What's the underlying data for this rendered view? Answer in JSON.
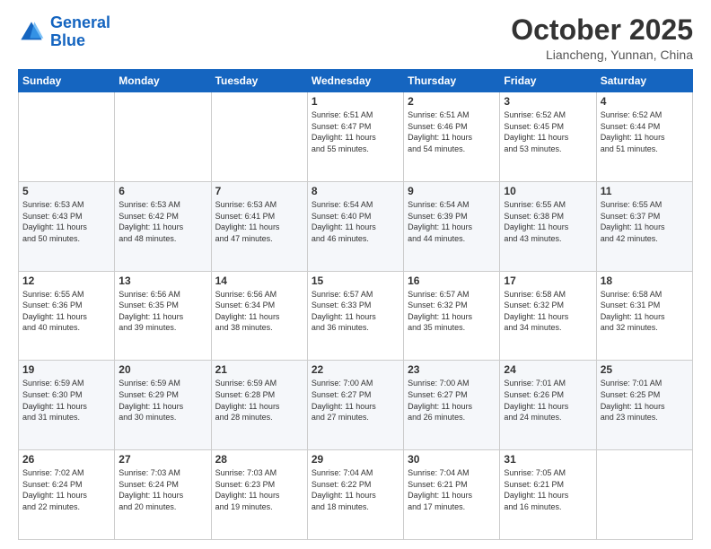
{
  "header": {
    "logo_line1": "General",
    "logo_line2": "Blue",
    "month": "October 2025",
    "location": "Liancheng, Yunnan, China"
  },
  "days_of_week": [
    "Sunday",
    "Monday",
    "Tuesday",
    "Wednesday",
    "Thursday",
    "Friday",
    "Saturday"
  ],
  "weeks": [
    [
      {
        "day": "",
        "info": ""
      },
      {
        "day": "",
        "info": ""
      },
      {
        "day": "",
        "info": ""
      },
      {
        "day": "1",
        "info": "Sunrise: 6:51 AM\nSunset: 6:47 PM\nDaylight: 11 hours\nand 55 minutes."
      },
      {
        "day": "2",
        "info": "Sunrise: 6:51 AM\nSunset: 6:46 PM\nDaylight: 11 hours\nand 54 minutes."
      },
      {
        "day": "3",
        "info": "Sunrise: 6:52 AM\nSunset: 6:45 PM\nDaylight: 11 hours\nand 53 minutes."
      },
      {
        "day": "4",
        "info": "Sunrise: 6:52 AM\nSunset: 6:44 PM\nDaylight: 11 hours\nand 51 minutes."
      }
    ],
    [
      {
        "day": "5",
        "info": "Sunrise: 6:53 AM\nSunset: 6:43 PM\nDaylight: 11 hours\nand 50 minutes."
      },
      {
        "day": "6",
        "info": "Sunrise: 6:53 AM\nSunset: 6:42 PM\nDaylight: 11 hours\nand 48 minutes."
      },
      {
        "day": "7",
        "info": "Sunrise: 6:53 AM\nSunset: 6:41 PM\nDaylight: 11 hours\nand 47 minutes."
      },
      {
        "day": "8",
        "info": "Sunrise: 6:54 AM\nSunset: 6:40 PM\nDaylight: 11 hours\nand 46 minutes."
      },
      {
        "day": "9",
        "info": "Sunrise: 6:54 AM\nSunset: 6:39 PM\nDaylight: 11 hours\nand 44 minutes."
      },
      {
        "day": "10",
        "info": "Sunrise: 6:55 AM\nSunset: 6:38 PM\nDaylight: 11 hours\nand 43 minutes."
      },
      {
        "day": "11",
        "info": "Sunrise: 6:55 AM\nSunset: 6:37 PM\nDaylight: 11 hours\nand 42 minutes."
      }
    ],
    [
      {
        "day": "12",
        "info": "Sunrise: 6:55 AM\nSunset: 6:36 PM\nDaylight: 11 hours\nand 40 minutes."
      },
      {
        "day": "13",
        "info": "Sunrise: 6:56 AM\nSunset: 6:35 PM\nDaylight: 11 hours\nand 39 minutes."
      },
      {
        "day": "14",
        "info": "Sunrise: 6:56 AM\nSunset: 6:34 PM\nDaylight: 11 hours\nand 38 minutes."
      },
      {
        "day": "15",
        "info": "Sunrise: 6:57 AM\nSunset: 6:33 PM\nDaylight: 11 hours\nand 36 minutes."
      },
      {
        "day": "16",
        "info": "Sunrise: 6:57 AM\nSunset: 6:32 PM\nDaylight: 11 hours\nand 35 minutes."
      },
      {
        "day": "17",
        "info": "Sunrise: 6:58 AM\nSunset: 6:32 PM\nDaylight: 11 hours\nand 34 minutes."
      },
      {
        "day": "18",
        "info": "Sunrise: 6:58 AM\nSunset: 6:31 PM\nDaylight: 11 hours\nand 32 minutes."
      }
    ],
    [
      {
        "day": "19",
        "info": "Sunrise: 6:59 AM\nSunset: 6:30 PM\nDaylight: 11 hours\nand 31 minutes."
      },
      {
        "day": "20",
        "info": "Sunrise: 6:59 AM\nSunset: 6:29 PM\nDaylight: 11 hours\nand 30 minutes."
      },
      {
        "day": "21",
        "info": "Sunrise: 6:59 AM\nSunset: 6:28 PM\nDaylight: 11 hours\nand 28 minutes."
      },
      {
        "day": "22",
        "info": "Sunrise: 7:00 AM\nSunset: 6:27 PM\nDaylight: 11 hours\nand 27 minutes."
      },
      {
        "day": "23",
        "info": "Sunrise: 7:00 AM\nSunset: 6:27 PM\nDaylight: 11 hours\nand 26 minutes."
      },
      {
        "day": "24",
        "info": "Sunrise: 7:01 AM\nSunset: 6:26 PM\nDaylight: 11 hours\nand 24 minutes."
      },
      {
        "day": "25",
        "info": "Sunrise: 7:01 AM\nSunset: 6:25 PM\nDaylight: 11 hours\nand 23 minutes."
      }
    ],
    [
      {
        "day": "26",
        "info": "Sunrise: 7:02 AM\nSunset: 6:24 PM\nDaylight: 11 hours\nand 22 minutes."
      },
      {
        "day": "27",
        "info": "Sunrise: 7:03 AM\nSunset: 6:24 PM\nDaylight: 11 hours\nand 20 minutes."
      },
      {
        "day": "28",
        "info": "Sunrise: 7:03 AM\nSunset: 6:23 PM\nDaylight: 11 hours\nand 19 minutes."
      },
      {
        "day": "29",
        "info": "Sunrise: 7:04 AM\nSunset: 6:22 PM\nDaylight: 11 hours\nand 18 minutes."
      },
      {
        "day": "30",
        "info": "Sunrise: 7:04 AM\nSunset: 6:21 PM\nDaylight: 11 hours\nand 17 minutes."
      },
      {
        "day": "31",
        "info": "Sunrise: 7:05 AM\nSunset: 6:21 PM\nDaylight: 11 hours\nand 16 minutes."
      },
      {
        "day": "",
        "info": ""
      }
    ]
  ]
}
